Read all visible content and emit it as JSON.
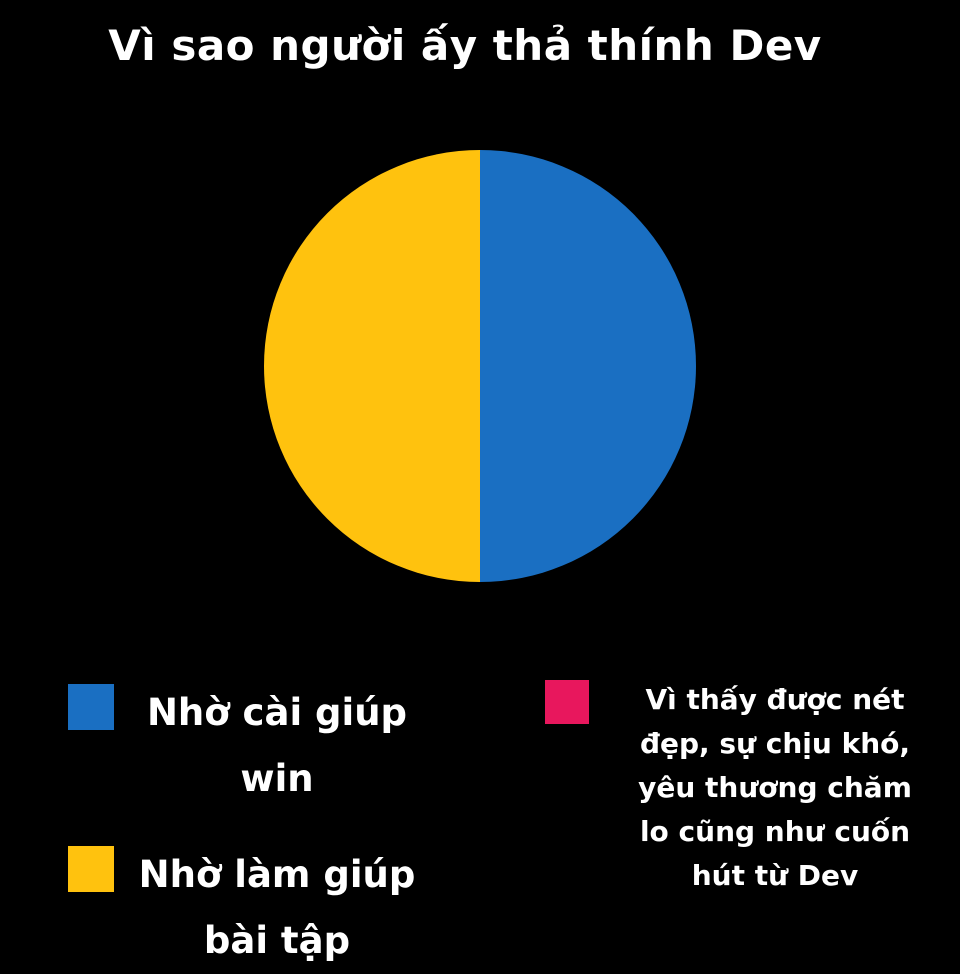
{
  "chart_data": {
    "type": "pie",
    "title": "Vì sao người ấy thả thính Dev",
    "legend_position": "bottom",
    "slices": [
      {
        "label": "Nhờ cài giúp win",
        "value": 50,
        "color": "#1a6fc2"
      },
      {
        "label": "Nhờ làm giúp bài tập",
        "value": 50,
        "color": "#ffc20e"
      },
      {
        "label": "Vì thấy được nét đẹp, sự chịu khó, yêu thương chăm lo cũng như cuốn hút từ Dev",
        "value": 0,
        "color": "#e8175d"
      }
    ]
  }
}
